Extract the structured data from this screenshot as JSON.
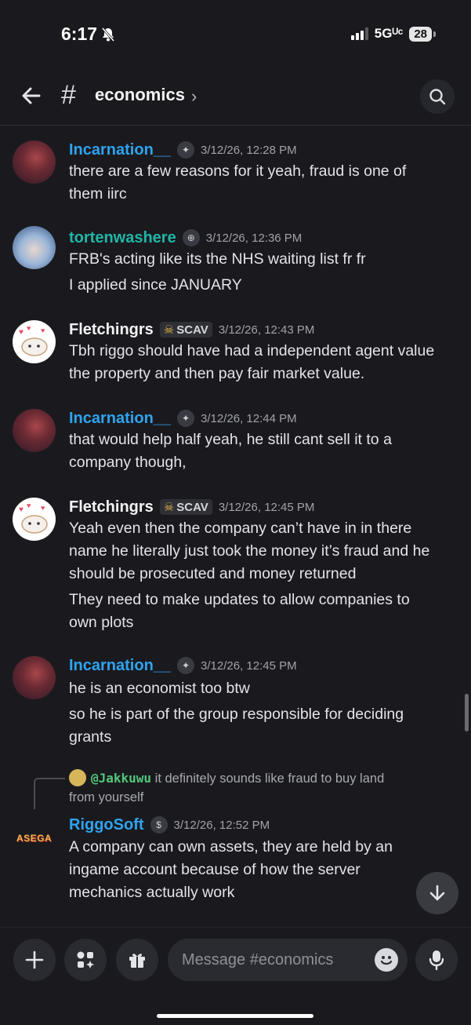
{
  "status": {
    "time": "6:17",
    "network": "5Gᵁᶜ",
    "battery": "28"
  },
  "header": {
    "channel": "economics"
  },
  "messages": [
    {
      "user": "Incarnation__",
      "color": "#2fa3f0",
      "time": "3/12/26, 12:28 PM",
      "lines": [
        "there are a few reasons for it yeah, fraud is one of",
        "them iirc"
      ]
    },
    {
      "user": "tortenwashere",
      "color": "#1fb6a8",
      "time": "3/12/26, 12:36 PM",
      "lines": [
        "FRB's acting like its the NHS waiting list fr fr",
        "I applied since JANUARY"
      ]
    },
    {
      "user": "Fletchingrs",
      "color": "#f2f3f5",
      "tag": "SCAV",
      "time": "3/12/26, 12:43 PM",
      "lines": [
        "Tbh riggo should have had a independent agent value",
        "the property and then pay fair market value."
      ]
    },
    {
      "user": "Incarnation__",
      "color": "#2fa3f0",
      "time": "3/12/26, 12:44 PM",
      "lines": [
        "that would help half yeah, he still cant sell it to a",
        "company though,"
      ]
    },
    {
      "user": "Fletchingrs",
      "color": "#f2f3f5",
      "tag": "SCAV",
      "time": "3/12/26, 12:45 PM",
      "lines": [
        "Yeah even then the company can’t have in in there",
        "name he literally just took the money it’s fraud and he",
        "should be prosecuted and money returned",
        "They need to make updates to allow companies to",
        "own plots"
      ]
    },
    {
      "user": "Incarnation__",
      "color": "#2fa3f0",
      "time": "3/12/26, 12:45 PM",
      "lines": [
        "he is an economist too btw",
        "so he is part of the group responsible for deciding",
        "grants"
      ]
    },
    {
      "user": "RiggoSoft",
      "color": "#2fa3f0",
      "time": "3/12/26, 12:52 PM",
      "avatar_text": "ASEGA",
      "reply": {
        "user": "@Jakkuwu",
        "text_a": "it definitely sounds like fraud to buy land",
        "text_b": "from yourself"
      },
      "lines": [
        "A company can own assets, they are held by an",
        "ingame account because of how the server",
        "mechanics actually work"
      ]
    }
  ],
  "composer": {
    "placeholder": "Message #economics"
  }
}
